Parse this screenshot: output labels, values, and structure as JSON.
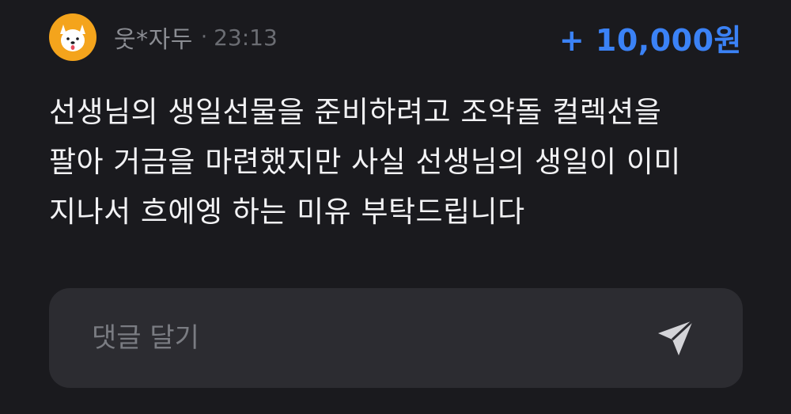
{
  "post": {
    "username": "웃*자두",
    "separator": "·",
    "time": "23:13",
    "donation_amount": "+ 10,000원",
    "message_lines": [
      "선생님의 생일선물을 준비하려고 조약돌 컬렉션을",
      "팔아 거금을 마련했지만 사실 선생님의 생일이 이미",
      "지나서 흐에엥 하는 미유 부탁드립니다"
    ],
    "avatar_icon": "dog-face-icon"
  },
  "comment": {
    "placeholder": "댓글 달기",
    "value": "",
    "send_icon": "paper-plane-icon"
  },
  "colors": {
    "background": "#1a1a1e",
    "avatar_bg": "#f4a41c",
    "accent": "#3b82f6",
    "input_bg": "#2c2c31"
  }
}
